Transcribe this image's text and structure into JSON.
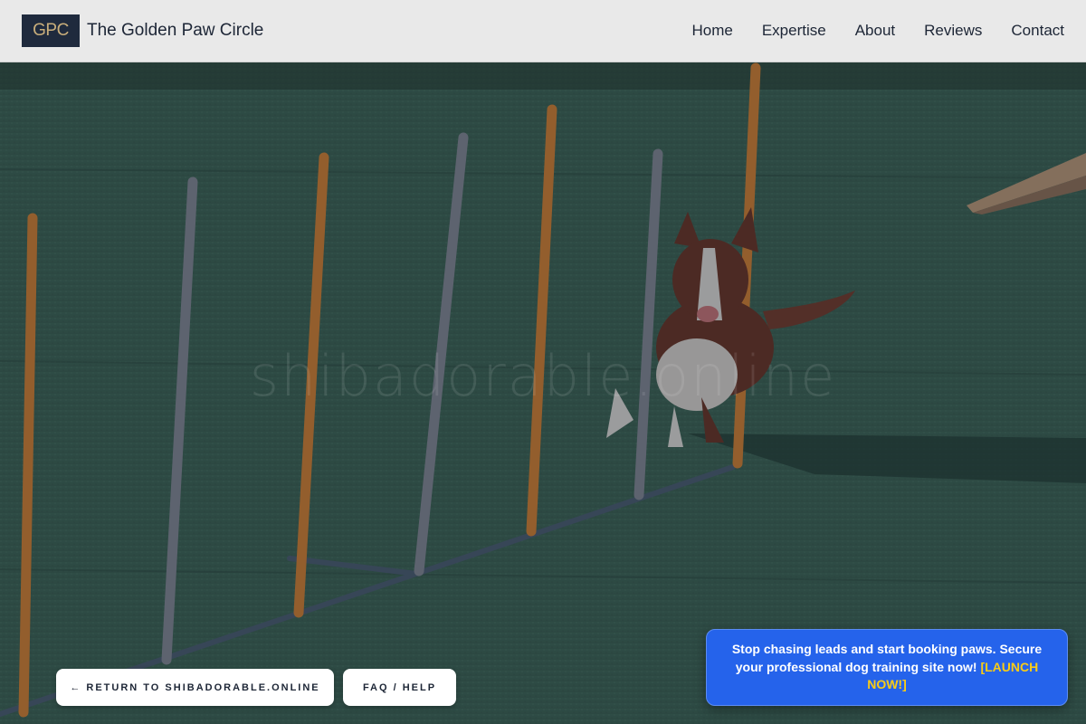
{
  "header": {
    "logo_text": "GPC",
    "site_name": "The Golden Paw Circle",
    "nav": [
      "Home",
      "Expertise",
      "About",
      "Reviews",
      "Contact"
    ]
  },
  "hero": {
    "watermark": "shibadorable.online",
    "image_subject": "border collie running through agility weave poles"
  },
  "buttons": {
    "return_label": "← Return to shibadorable.online",
    "faq_label": "FAQ / Help"
  },
  "promo": {
    "message": "Stop chasing leads and start booking paws. Secure your professional dog training site now!",
    "cta": "[LAUNCH NOW!]"
  },
  "colors": {
    "header_bg": "#e9e9e9",
    "logo_bg": "#1f2a3d",
    "logo_text": "#c9ae7b",
    "promo_bg": "#2563eb",
    "promo_cta": "#facc15",
    "turf": "#2f4a3e"
  }
}
